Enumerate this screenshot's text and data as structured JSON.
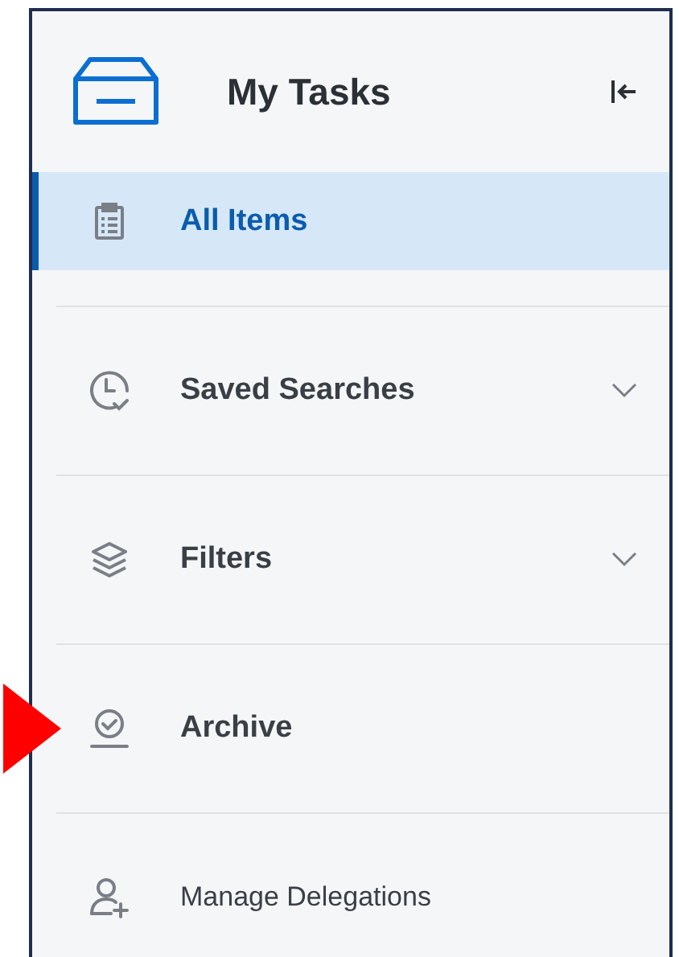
{
  "panel": {
    "title": "My Tasks"
  },
  "items": [
    {
      "label": "All Items",
      "kind": "section",
      "selected": true
    },
    {
      "label": "Saved Searches",
      "kind": "section",
      "selected": false,
      "expanded": false
    },
    {
      "label": "Filters",
      "kind": "section",
      "selected": false,
      "expanded": false
    },
    {
      "label": "Archive",
      "kind": "section",
      "selected": false,
      "pointed": true
    },
    {
      "label": "Manage Delegations",
      "kind": "action",
      "selected": false
    }
  ]
}
